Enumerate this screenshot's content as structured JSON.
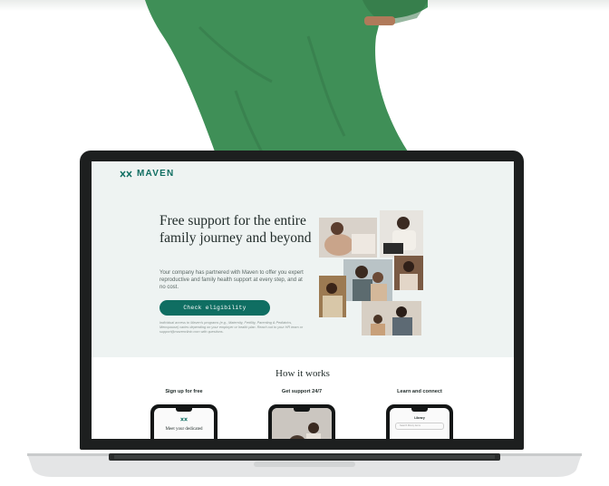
{
  "page": {
    "brand": "MAVEN",
    "hero": {
      "title": "Free support for the entire family journey and beyond",
      "description": "Your company has partnered with Maven to offer you expert reproductive and family health support at every step, and at no cost.",
      "cta_label": "Check eligibility",
      "fine_print": "Individual access to Maven's programs (e.g., Maternity, Fertility, Parenting & Pediatrics, Menopause) varies depending on your employer or health plan. Reach out to your HR team or support@mavenclinic.com with questions."
    },
    "how_it_works": {
      "title": "How it works",
      "steps": [
        {
          "label": "Sign up for free",
          "phone_text": "Meet your dedicated"
        },
        {
          "label": "Get support 24/7",
          "phone_text": ""
        },
        {
          "label": "Learn and connect",
          "phone_text": "Library",
          "phone_search": "Search library items"
        }
      ]
    }
  },
  "colors": {
    "brand_green": "#0f6e62",
    "screen_bg": "#eef3f2",
    "shirt_green": "#3f8f57"
  },
  "icons": {
    "logo": "maven-logo-icon"
  }
}
